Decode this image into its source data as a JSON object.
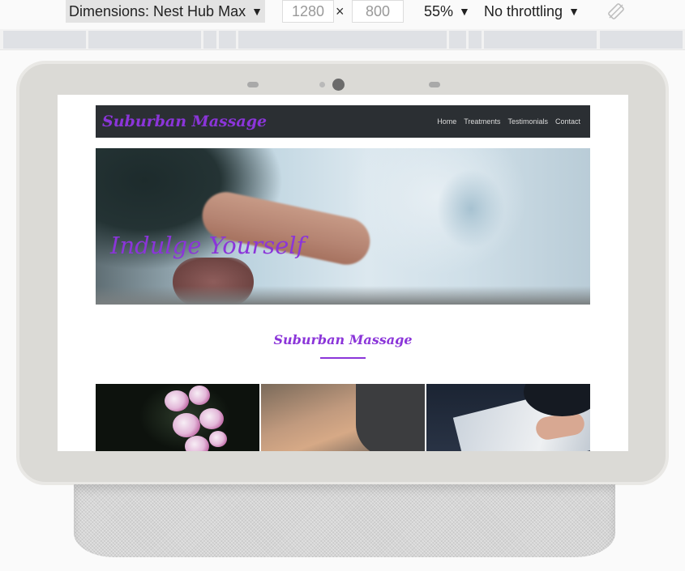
{
  "devtools": {
    "device_label": "Dimensions: Nest Hub Max",
    "width_value": "1280",
    "times_symbol": "×",
    "height_value": "800",
    "zoom_label": "55%",
    "throttle_label": "No throttling",
    "caret": "▼",
    "rotate_icon": "rotate-icon"
  },
  "site": {
    "brand": "Suburban Massage",
    "nav": [
      "Home",
      "Treatments",
      "Testimonials",
      "Contact"
    ],
    "hero_title": "Indulge Yourself",
    "section_title": "Suburban Massage",
    "accent_color": "#8b35d9",
    "nav_bg_color": "#2b2f33"
  }
}
